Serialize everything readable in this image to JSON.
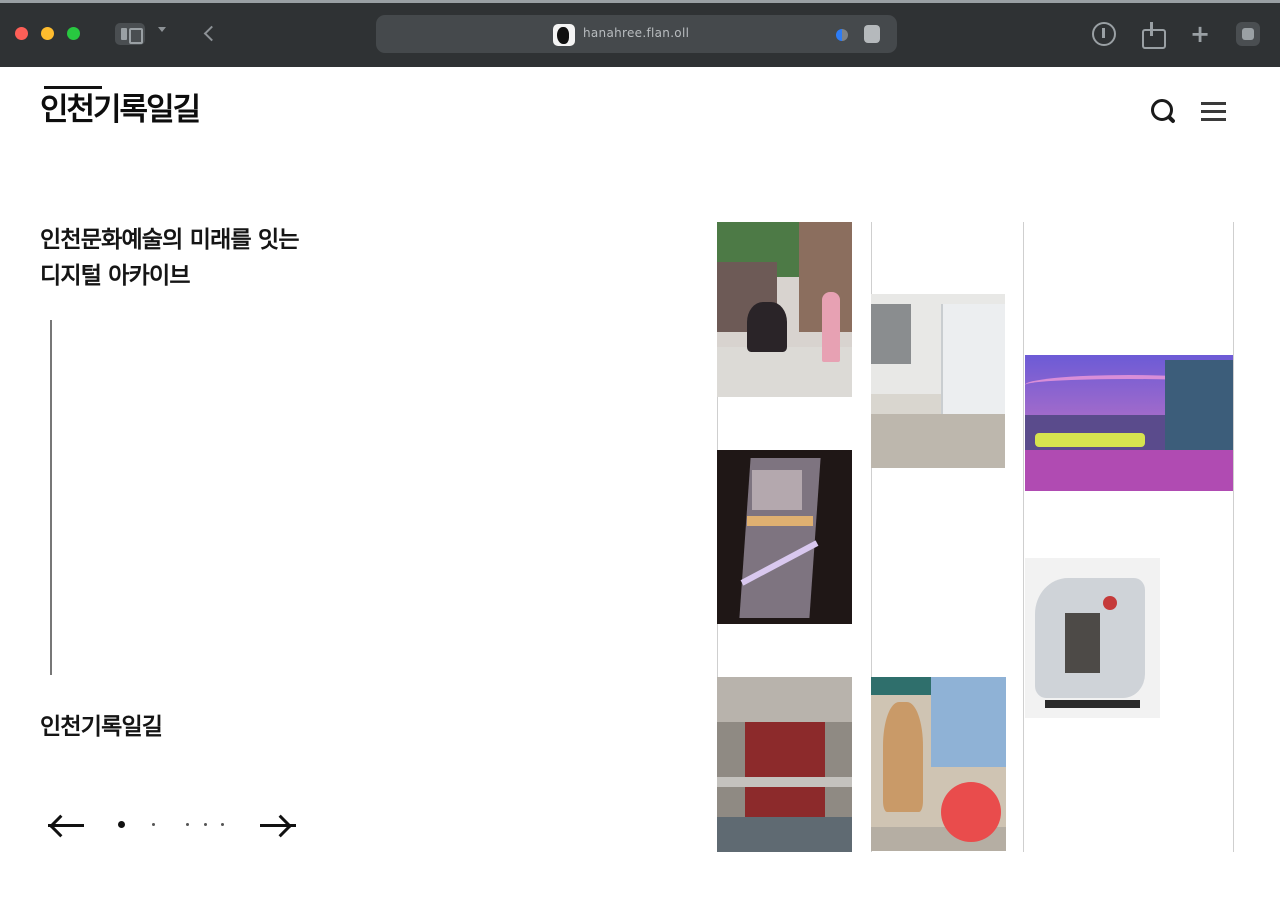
{
  "browser": {
    "url": "hanahree.flan.oll"
  },
  "site": {
    "logo": "인천기록일길"
  },
  "hero": {
    "tagline_line1": "인천문화예술의 미래를 잇는",
    "tagline_line2": "디지털 아카이브"
  },
  "section": {
    "title": "인천기록일길"
  },
  "carousel": {
    "total_slides": 5,
    "active_slide": 1
  },
  "gallery": {
    "columns": 3,
    "items": [
      {
        "id": "street-performance",
        "column": 1
      },
      {
        "id": "white-corridor",
        "column": 2
      },
      {
        "id": "colorful-underpass",
        "column": 3
      },
      {
        "id": "illuminated-tower",
        "column": 1
      },
      {
        "id": "sculpture-cutout",
        "column": 3
      },
      {
        "id": "red-installation",
        "column": 1
      },
      {
        "id": "painted-figure",
        "column": 2
      }
    ]
  },
  "colors": {
    "chrome_background": "#2f3234",
    "page_background": "#ffffff",
    "text": "#151515"
  }
}
